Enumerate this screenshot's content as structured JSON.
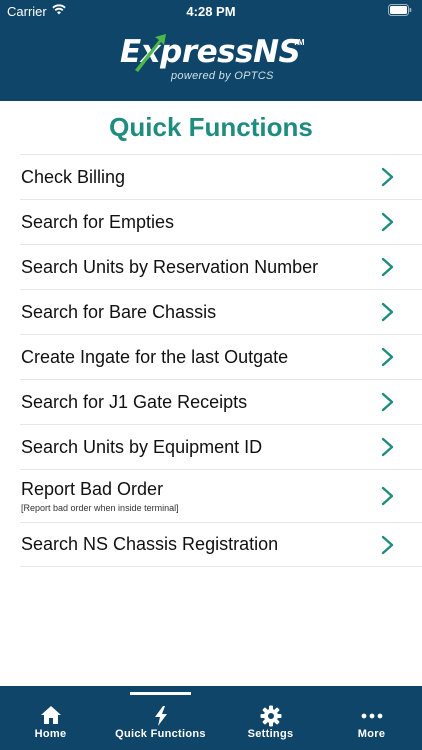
{
  "status_bar": {
    "carrier": "Carrier",
    "time": "4:28 PM"
  },
  "logo": {
    "wordmark": "ExpressNS",
    "trademark": "TM",
    "tagline": "powered by OPTCS"
  },
  "title": "Quick Functions",
  "functions": [
    {
      "label": "Check Billing"
    },
    {
      "label": "Search for Empties"
    },
    {
      "label": "Search Units by Reservation Number"
    },
    {
      "label": "Search for Bare Chassis"
    },
    {
      "label": "Create Ingate for the last Outgate"
    },
    {
      "label": "Search for J1 Gate Receipts"
    },
    {
      "label": "Search Units by Equipment ID"
    },
    {
      "label": "Report Bad Order",
      "sublabel": "[Report bad order when inside terminal]"
    },
    {
      "label": "Search NS Chassis Registration"
    }
  ],
  "tabs": [
    {
      "label": "Home",
      "icon": "home-icon"
    },
    {
      "label": "Quick Functions",
      "icon": "lightning-icon",
      "active": true
    },
    {
      "label": "Settings",
      "icon": "gear-icon"
    },
    {
      "label": "More",
      "icon": "more-dots-icon"
    }
  ],
  "colors": {
    "header": "#0f4569",
    "accent": "#1f8c80",
    "logo_arrow": "#4cb84c"
  }
}
